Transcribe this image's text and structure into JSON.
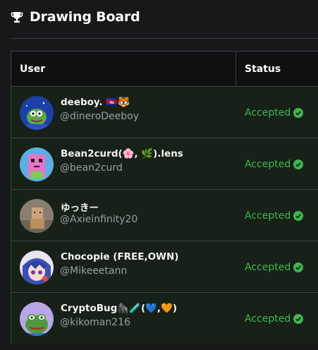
{
  "header": {
    "title": "Drawing Board",
    "icon": "trophy-icon"
  },
  "table": {
    "columns": {
      "user": "User",
      "status": "Status"
    },
    "rows": [
      {
        "name": "deeboy. 🇰🇭🐯",
        "handle": "@dineroDeeboy",
        "status": "Accepted"
      },
      {
        "name": "Bean2curd(🌸, 🌿).lens",
        "handle": "@bean2curd",
        "status": "Accepted"
      },
      {
        "name": "ゆっきー",
        "handle": "@Axieinfinity20",
        "status": "Accepted"
      },
      {
        "name": "Chocopie (FREE,OWN)",
        "handle": "@Mikeeetann",
        "status": "Accepted"
      },
      {
        "name": "CryptoBug🦍🧪(💙,🧡)",
        "handle": "@kikoman216",
        "status": "Accepted"
      }
    ]
  },
  "colors": {
    "accepted": "#3fb552",
    "row_bg": "#172117",
    "page_bg": "#16181a"
  }
}
